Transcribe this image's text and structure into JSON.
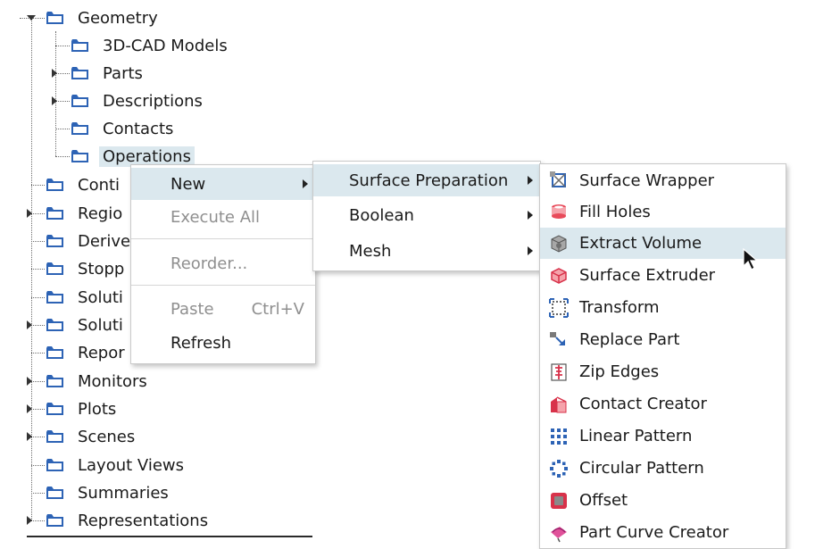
{
  "tree": {
    "items": [
      {
        "label": "Geometry",
        "expander": "expanded"
      },
      {
        "label": "3D-CAD Models",
        "expander": "none"
      },
      {
        "label": "Parts",
        "expander": "collapsed"
      },
      {
        "label": "Descriptions",
        "expander": "collapsed"
      },
      {
        "label": "Contacts",
        "expander": "none"
      },
      {
        "label": "Operations",
        "expander": "none",
        "selected": true
      },
      {
        "label": "Conti",
        "expander": "none"
      },
      {
        "label": "Regio",
        "expander": "collapsed"
      },
      {
        "label": "Derive",
        "expander": "none"
      },
      {
        "label": "Stopp",
        "expander": "none"
      },
      {
        "label": "Soluti",
        "expander": "none"
      },
      {
        "label": "Soluti",
        "expander": "collapsed"
      },
      {
        "label": "Repor",
        "expander": "none"
      },
      {
        "label": "Monitors",
        "expander": "collapsed"
      },
      {
        "label": "Plots",
        "expander": "collapsed"
      },
      {
        "label": "Scenes",
        "expander": "collapsed"
      },
      {
        "label": "Layout Views",
        "expander": "none"
      },
      {
        "label": "Summaries",
        "expander": "none"
      },
      {
        "label": "Representations",
        "expander": "collapsed"
      }
    ]
  },
  "context_menu": {
    "items": [
      {
        "label": "New",
        "enabled": true,
        "submenu": true,
        "highlighted": true
      },
      {
        "label": "Execute All",
        "enabled": false
      },
      {
        "label": "Reorder...",
        "enabled": false
      },
      {
        "label": "Paste",
        "shortcut": "Ctrl+V",
        "enabled": false
      },
      {
        "label": "Refresh",
        "enabled": true
      }
    ]
  },
  "new_submenu": {
    "items": [
      {
        "label": "Surface Preparation",
        "submenu": true,
        "highlighted": true
      },
      {
        "label": "Boolean",
        "submenu": true
      },
      {
        "label": "Mesh",
        "submenu": true
      }
    ]
  },
  "surface_prep_submenu": {
    "items": [
      {
        "label": "Surface Wrapper",
        "icon": "surface-wrapper-icon"
      },
      {
        "label": "Fill Holes",
        "icon": "fill-holes-icon"
      },
      {
        "label": "Extract Volume",
        "icon": "extract-volume-icon",
        "highlighted": true
      },
      {
        "label": "Surface Extruder",
        "icon": "surface-extruder-icon"
      },
      {
        "label": "Transform",
        "icon": "transform-icon"
      },
      {
        "label": "Replace Part",
        "icon": "replace-part-icon"
      },
      {
        "label": "Zip Edges",
        "icon": "zip-edges-icon"
      },
      {
        "label": "Contact Creator",
        "icon": "contact-creator-icon"
      },
      {
        "label": "Linear Pattern",
        "icon": "linear-pattern-icon"
      },
      {
        "label": "Circular Pattern",
        "icon": "circular-pattern-icon"
      },
      {
        "label": "Offset",
        "icon": "offset-icon"
      },
      {
        "label": "Part Curve Creator",
        "icon": "part-curve-creator-icon"
      }
    ]
  },
  "colors": {
    "highlight": "#dbe8ee",
    "folder": "#2d63b5",
    "disabled_text": "#8f8f8f"
  }
}
